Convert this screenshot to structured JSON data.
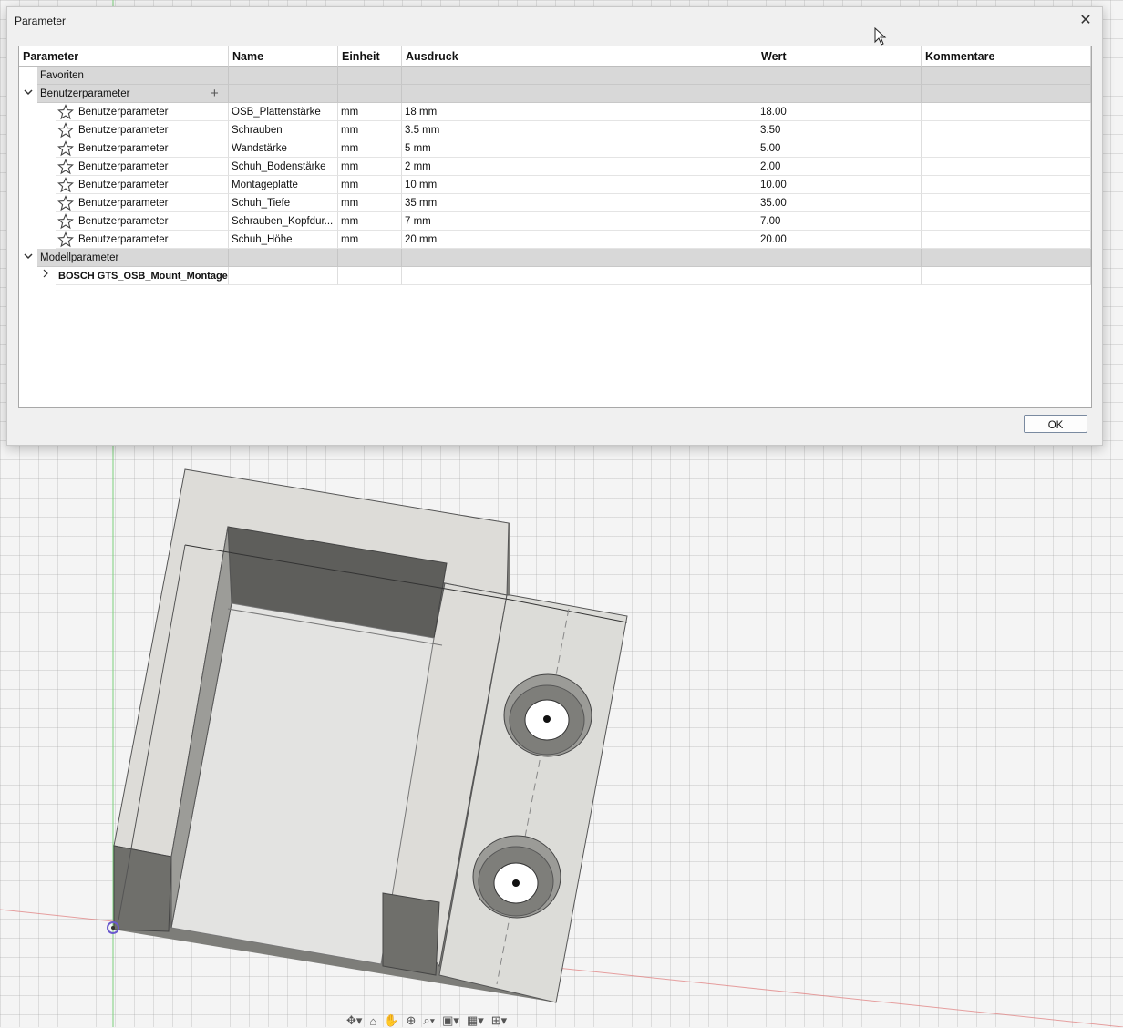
{
  "dialog": {
    "title": "Parameter",
    "ok_label": "OK"
  },
  "table": {
    "columns": [
      "Parameter",
      "Name",
      "Einheit",
      "Ausdruck",
      "Wert",
      "Kommentare"
    ],
    "groups": {
      "favorites": "Favoriten",
      "user": "Benutzerparameter",
      "model": "Modellparameter"
    },
    "user_rows": [
      {
        "param": "Benutzerparameter",
        "name": "OSB_Plattenstärke",
        "unit": "mm",
        "expr": "18 mm",
        "value": "18.00",
        "comment": ""
      },
      {
        "param": "Benutzerparameter",
        "name": "Schrauben",
        "unit": "mm",
        "expr": "3.5 mm",
        "value": "3.50",
        "comment": ""
      },
      {
        "param": "Benutzerparameter",
        "name": "Wandstärke",
        "unit": "mm",
        "expr": "5 mm",
        "value": "5.00",
        "comment": ""
      },
      {
        "param": "Benutzerparameter",
        "name": "Schuh_Bodenstärke",
        "unit": "mm",
        "expr": "2 mm",
        "value": "2.00",
        "comment": ""
      },
      {
        "param": "Benutzerparameter",
        "name": "Montageplatte",
        "unit": "mm",
        "expr": "10 mm",
        "value": "10.00",
        "comment": ""
      },
      {
        "param": "Benutzerparameter",
        "name": "Schuh_Tiefe",
        "unit": "mm",
        "expr": "35 mm",
        "value": "35.00",
        "comment": ""
      },
      {
        "param": "Benutzerparameter",
        "name": "Schrauben_Kopfdur...",
        "unit": "mm",
        "expr": "7 mm",
        "value": "7.00",
        "comment": ""
      },
      {
        "param": "Benutzerparameter",
        "name": "Schuh_Höhe",
        "unit": "mm",
        "expr": "20 mm",
        "value": "20.00",
        "comment": ""
      }
    ],
    "model_child": "BOSCH GTS_OSB_Mount_Montage..."
  },
  "icons": {
    "close": "close-icon",
    "add": "plus-icon",
    "favorite": "star-icon",
    "expand": "chevron-right-icon",
    "collapse": "chevron-down-icon"
  },
  "colors": {
    "group_bg": "#d8d8d8",
    "model_face": "#dcdcd8",
    "model_side": "#8a8a86"
  }
}
